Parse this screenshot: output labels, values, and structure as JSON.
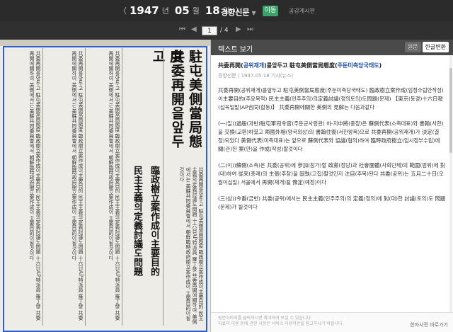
{
  "topbar": {
    "prev_label": "〈",
    "year": "1947",
    "year_unit": "년",
    "month": "05",
    "month_unit": "월",
    "day": "18",
    "day_unit": "일",
    "next_label": "〉",
    "newspaper": "경향신문",
    "go_label": "이동",
    "notice_label": "공감게시판"
  },
  "pager": {
    "first": "⏮",
    "prev": "◀",
    "current_page": "1",
    "total_pages": "/ 4",
    "next": "▶",
    "last": "⏭"
  },
  "scan": {
    "headline_main": "共委再開을앞두고",
    "headline_sub": "駐屯美側當局態度",
    "subhead": "臨政樹立案作成이主要目的",
    "subhead2": "民主主義의定義討議도問題",
    "column_text": "共委再開를앞두고 駐屯美側當局態度 臨政樹立案作成이主要目的 民主主義의定義討議도問題 十六日AP特派員 羅丁發 共委再開에關하여 美側에서는 美蘇共同委員會에서 朝鮮臨時政府樹立案作成이 主要目的이될것이다"
  },
  "panel": {
    "header": "텍스트 보기",
    "tab_original": "원문",
    "tab_korean": "한글변환",
    "title_prefix": "共委再開(",
    "title_hl1": "공위재개",
    "title_mid": ")를앞두고 駐屯美側當局態度(",
    "title_hl2": "주둔미측당국태도",
    "title_suffix": ")",
    "meta": "경향신문 | 1947.05.18 기사(뉴스)",
    "paragraphs": [
      "共委再開(공위재개)를앞두고 駐屯美側當局態度(주둔미측당국태도) 臨政樹立案作成(임정수립안작성)이主要目的(주요목적) 民主主義(민주주의)의定義討議(정의토의)도問題(문제) 【東京(동경)十六日發(십육일발)AP合同(합동)】 共委再開에關한 美側의 見解는 다음과같다",
      "(一(일))過般(과반)駐屯軍司令官(주둔군사령관) 하-지中將(중장)은 蘇側代表(소측대표)와 書翰(서한)을 交換(교환)하였고 兩國外相(양국외상)의 書翰往復(서한왕복)으로 共委再開(공위재개)가 決定(결정)되었다 美側代表(미측대표)는 앞으로 蘇側代表와 協議(협의)하여 臨時政府樹立(임시정부수립)에 關(관)한 案(안)을 作成(작성)할것이다",
      "(二(이))蘇側(소측)은 共委(공위)에 參加(참가)할 政黨(정당)과 社會團體(사회단체)의 範圍(범위)에 對(대)하여 從來(종래)의 主張(주장)을 固執(고집)할것인지 注目(주목)된다 共委(공위)는 五月二十日(오월이십일) 서울에서 再開(재개)될 豫定(예정)이다",
      "(三(삼))今番(금번) 共委(공위)에서는 民主主義(민주주의)의 定義(정의)에 對(대)한 討議(토의)도 問題(문제)가 될것이다"
    ],
    "footer_line1": "원문이미지를 클릭하시면 확대하여 보실 수 있습니다.",
    "footer_line2": "자료의 이용 등에 관한 사항은 서비스 이용약관을 참고하시기 바랍니다.",
    "footer_link": "한자사전 바로가기"
  }
}
